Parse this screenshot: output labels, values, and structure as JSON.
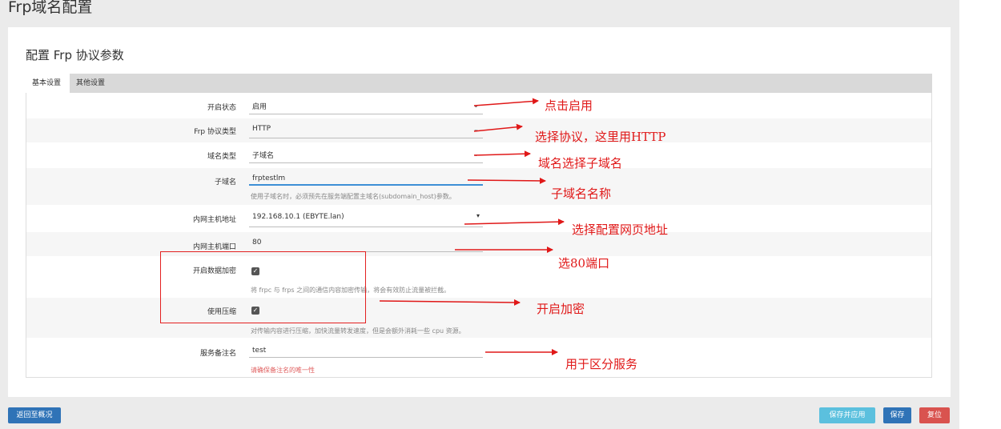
{
  "page": {
    "title": "Frp域名配置"
  },
  "section": {
    "title": "配置 Frp 协议参数"
  },
  "tabs": [
    {
      "label": "基本设置",
      "active": true
    },
    {
      "label": "其他设置",
      "active": false
    }
  ],
  "form": {
    "enable_status": {
      "label": "开启状态",
      "value": "启用"
    },
    "protocol_type": {
      "label": "Frp 协议类型",
      "value": "HTTP"
    },
    "domain_type": {
      "label": "域名类型",
      "value": "子域名"
    },
    "subdomain": {
      "label": "子域名",
      "value": "frptestlm",
      "hint": "使用子域名时，必须预先在服务端配置主域名(subdomain_host)参数。"
    },
    "lan_host": {
      "label": "内网主机地址",
      "value": "192.168.10.1 (EBYTE.lan)"
    },
    "lan_port": {
      "label": "内网主机端口",
      "value": "80"
    },
    "encryption": {
      "label": "开启数据加密",
      "checked": true,
      "hint": "将 frpc 与 frps 之间的通信内容加密传输，将会有效防止流量被拦截。"
    },
    "compression": {
      "label": "使用压缩",
      "checked": true,
      "hint": "对传输内容进行压缩，加快流量转发速度，但是会额外消耗一些 cpu 资源。"
    },
    "service_note": {
      "label": "服务备注名",
      "value": "test",
      "hint": "请确保备注名的唯一性"
    }
  },
  "annotations": {
    "a1": "点击启用",
    "a2": "选择协议，这里用HTTP",
    "a3": "域名选择子域名",
    "a4": "子域名名称",
    "a5": "选择配置网页地址",
    "a6": "选80端口",
    "a7": "开启加密",
    "a8": "用于区分服务"
  },
  "buttons": {
    "back": "返回至概况",
    "save_apply": "保存并应用",
    "save": "保存",
    "reset": "复位"
  },
  "icons": {
    "caret": "caret-down-icon",
    "check": "checkbox-checked-icon"
  },
  "colors": {
    "annotation": "#e01818",
    "primary": "#2f73b7",
    "info": "#5bc0de",
    "danger": "#d9534f"
  }
}
